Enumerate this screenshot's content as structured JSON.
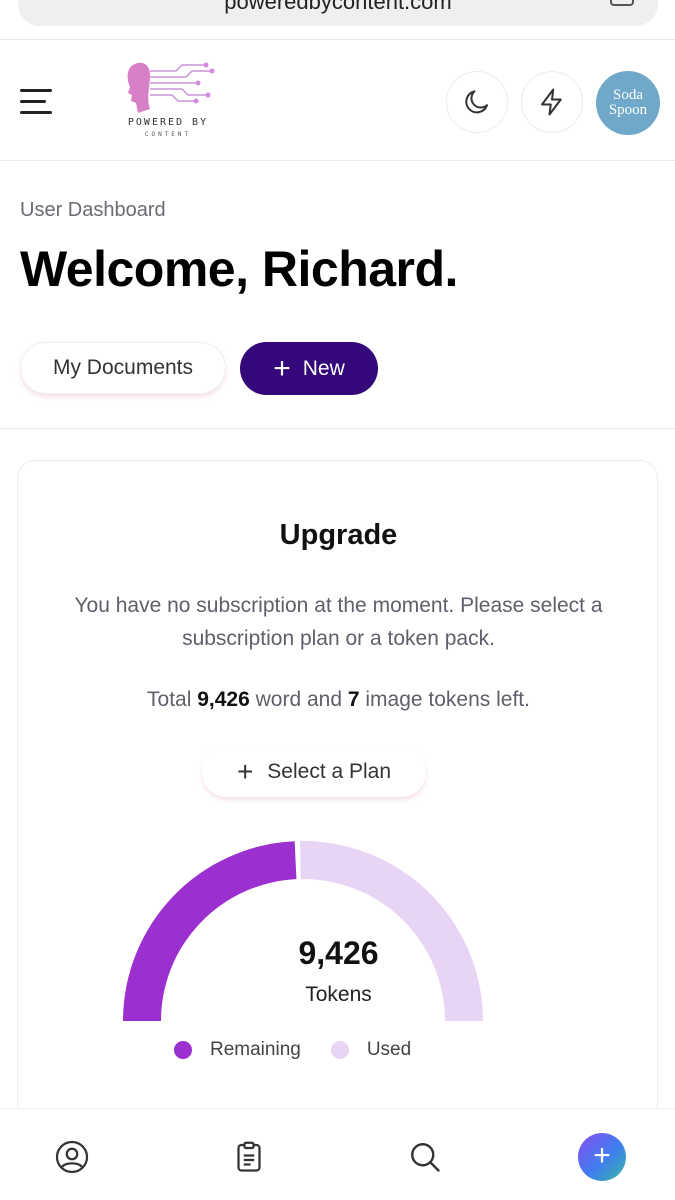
{
  "browser": {
    "url": "poweredbycontent.com"
  },
  "header": {
    "logo_text": "POWERED BY",
    "logo_sub": "CONTENT",
    "avatar_line1": "Soda",
    "avatar_line2": "Spoon"
  },
  "page": {
    "breadcrumb": "User Dashboard",
    "title": "Welcome, Richard.",
    "my_documents_label": "My Documents",
    "new_label": "New"
  },
  "card": {
    "title": "Upgrade",
    "description": "You have no subscription at the moment. Please select a subscription plan or a token pack.",
    "tokens_prefix": "Total ",
    "word_tokens": "9,426",
    "tokens_middle": " word and ",
    "image_tokens": "7",
    "tokens_suffix": " image tokens left.",
    "select_plan_label": "Select a Plan"
  },
  "chart_data": {
    "type": "pie",
    "subtype": "half-donut",
    "center_value": "9,426",
    "center_label": "Tokens",
    "slices": [
      {
        "name": "Remaining",
        "value": 0.49,
        "color": "#9b2fcf"
      },
      {
        "name": "Used",
        "value": 0.51,
        "color": "#e8d5f5"
      }
    ],
    "legend_position": "bottom"
  },
  "colors": {
    "primary": "#34077a",
    "remaining": "#9b2fcf",
    "used": "#e8d5f5"
  }
}
